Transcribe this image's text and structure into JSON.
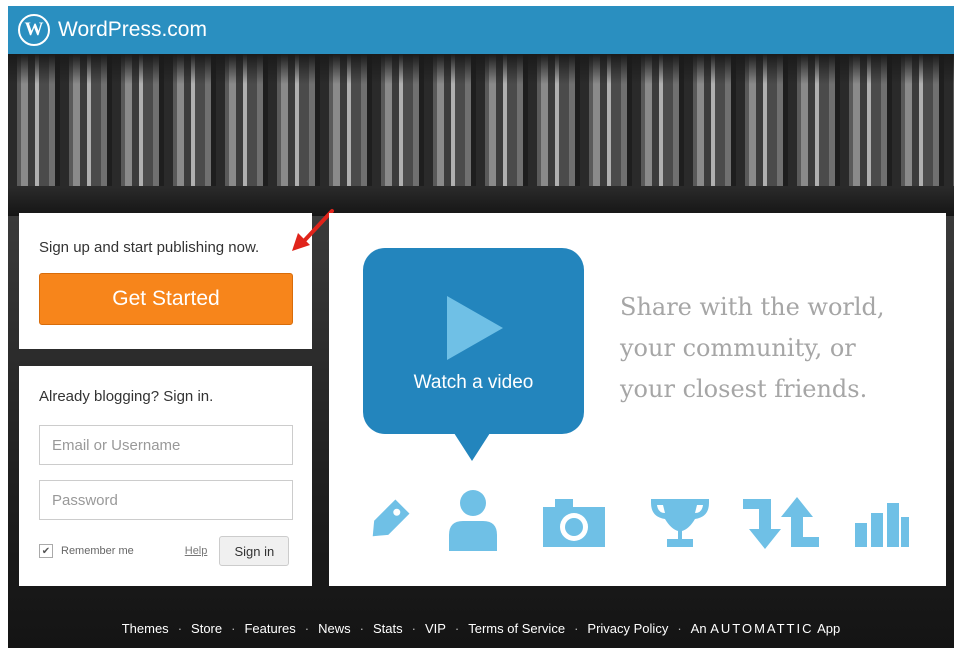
{
  "header": {
    "brand": "WordPress.com",
    "logo_letter": "W",
    "color": "#2a8fc0"
  },
  "signup": {
    "text": "Sign up and start publishing now.",
    "button_label": "Get Started",
    "button_color": "#f7851b",
    "arrow_color": "#e0241b"
  },
  "signin": {
    "heading": "Already blogging? Sign in.",
    "username_placeholder": "Email or Username",
    "password_placeholder": "Password",
    "remember_label": "Remember me",
    "remember_checked": true,
    "help_label": "Help",
    "signin_label": "Sign in"
  },
  "video": {
    "label": "Watch a video",
    "color": "#2385bd"
  },
  "tagline": {
    "line1": "Share with the world,",
    "line2": "your community, or",
    "line3": "your closest friends."
  },
  "feature_icons": [
    "tag-icon",
    "person-icon",
    "camera-icon",
    "trophy-icon",
    "sync-arrows-icon",
    "bar-chart-icon"
  ],
  "footer": {
    "links": [
      "Themes",
      "Store",
      "Features",
      "News",
      "Stats",
      "VIP",
      "Terms of Service",
      "Privacy Policy"
    ],
    "an": "An",
    "automattic": "AUTOMATTIC",
    "app": "App"
  }
}
